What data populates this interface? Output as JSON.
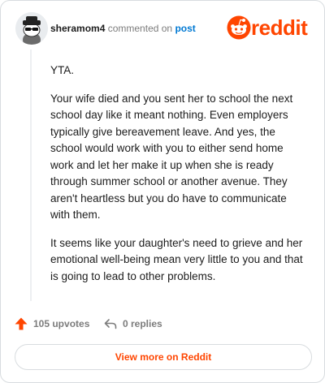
{
  "header": {
    "username": "sheramom4",
    "commented_text": "commented on",
    "post_link_label": "post",
    "brand_word": "reddit",
    "avatar_icon": "snoo-avatar-icon",
    "logo_icon": "reddit-alien-icon"
  },
  "comment": {
    "paragraphs": [
      "YTA.",
      "Your wife died and you sent her to school the next school day like it meant nothing. Even employers typically give bereavement leave. And yes, the school would work with you to either send home work and let her make it up when she is ready through summer school or another avenue. They aren't heartless but you do have to communicate with them.",
      "It seems like your daughter's need to grieve and her emotional well-being mean very little to you and that is going to lead to other problems."
    ]
  },
  "actions": {
    "upvotes_label": "105 upvotes",
    "replies_label": "0 replies",
    "upvote_icon": "upvote-arrow-icon",
    "reply_icon": "reply-arrow-icon"
  },
  "footer": {
    "view_more_label": "View more on Reddit"
  },
  "colors": {
    "brand": "#ff4500",
    "link": "#0079d3",
    "muted": "#7c7c7c",
    "border": "#d8dcdf"
  }
}
